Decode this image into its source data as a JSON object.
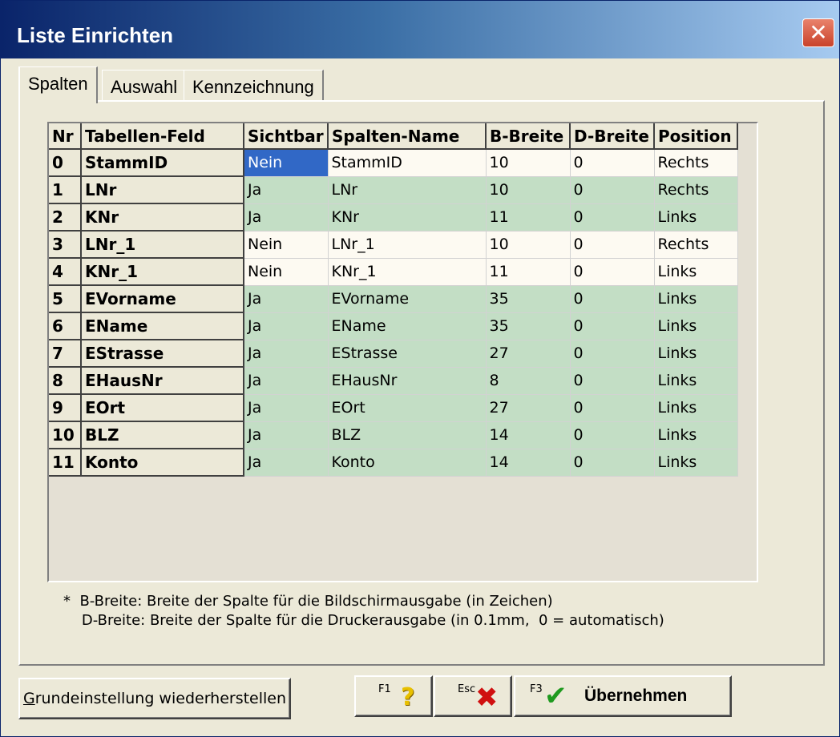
{
  "window": {
    "title": "Liste Einrichten",
    "close_glyph": "✕"
  },
  "tabs": [
    {
      "label": "Spalten",
      "active": true
    },
    {
      "label": "Auswahl",
      "active": false
    },
    {
      "label": "Kennzeichnung",
      "active": false
    }
  ],
  "grid": {
    "headers": [
      "Nr",
      "Tabellen-Feld",
      "Sichtbar",
      "Spalten-Name",
      "B-Breite",
      "D-Breite",
      "Position"
    ],
    "rows": [
      {
        "nr": "0",
        "feld": "StammID",
        "sichtbar": "Nein",
        "name": "StammID",
        "b": "10",
        "d": "0",
        "pos": "Rechts"
      },
      {
        "nr": "1",
        "feld": "LNr",
        "sichtbar": "Ja",
        "name": "LNr",
        "b": "10",
        "d": "0",
        "pos": "Rechts"
      },
      {
        "nr": "2",
        "feld": "KNr",
        "sichtbar": "Ja",
        "name": "KNr",
        "b": "11",
        "d": "0",
        "pos": "Links"
      },
      {
        "nr": "3",
        "feld": "LNr_1",
        "sichtbar": "Nein",
        "name": "LNr_1",
        "b": "10",
        "d": "0",
        "pos": "Rechts"
      },
      {
        "nr": "4",
        "feld": "KNr_1",
        "sichtbar": "Nein",
        "name": "KNr_1",
        "b": "11",
        "d": "0",
        "pos": "Links"
      },
      {
        "nr": "5",
        "feld": "EVorname",
        "sichtbar": "Ja",
        "name": "EVorname",
        "b": "35",
        "d": "0",
        "pos": "Links"
      },
      {
        "nr": "6",
        "feld": "EName",
        "sichtbar": "Ja",
        "name": "EName",
        "b": "35",
        "d": "0",
        "pos": "Links"
      },
      {
        "nr": "7",
        "feld": "EStrasse",
        "sichtbar": "Ja",
        "name": "EStrasse",
        "b": "27",
        "d": "0",
        "pos": "Links"
      },
      {
        "nr": "8",
        "feld": "EHausNr",
        "sichtbar": "Ja",
        "name": "EHausNr",
        "b": "8",
        "d": "0",
        "pos": "Links"
      },
      {
        "nr": "9",
        "feld": "EOrt",
        "sichtbar": "Ja",
        "name": "EOrt",
        "b": "27",
        "d": "0",
        "pos": "Links"
      },
      {
        "nr": "10",
        "feld": "BLZ",
        "sichtbar": "Ja",
        "name": "BLZ",
        "b": "14",
        "d": "0",
        "pos": "Links"
      },
      {
        "nr": "11",
        "feld": "Konto",
        "sichtbar": "Ja",
        "name": "Konto",
        "b": "14",
        "d": "0",
        "pos": "Links"
      }
    ],
    "selected_cell": "rows.0.sichtbar",
    "colors": {
      "visible_row": "#c3dec5",
      "hidden_row": "#fdfaf2",
      "selection": "#3168c6"
    }
  },
  "note": {
    "line1": "*  B-Breite: Breite der Spalte für die Bildschirmausgabe (in Zeichen)",
    "line2": "    D-Breite: Breite der Spalte für die Druckerausgabe (in 0.1mm,  0 = automatisch)"
  },
  "buttons": {
    "reset": {
      "mnemonic": "G",
      "rest": "rundeinstellung wiederherstellen"
    },
    "help": {
      "key": "F1",
      "icon": "question-icon",
      "glyph": "?"
    },
    "esc": {
      "key": "Esc",
      "icon": "x-icon",
      "glyph": "✖"
    },
    "ok": {
      "key": "F3",
      "icon": "checkmark-icon",
      "glyph": "✔",
      "label": "Übernehmen"
    }
  }
}
